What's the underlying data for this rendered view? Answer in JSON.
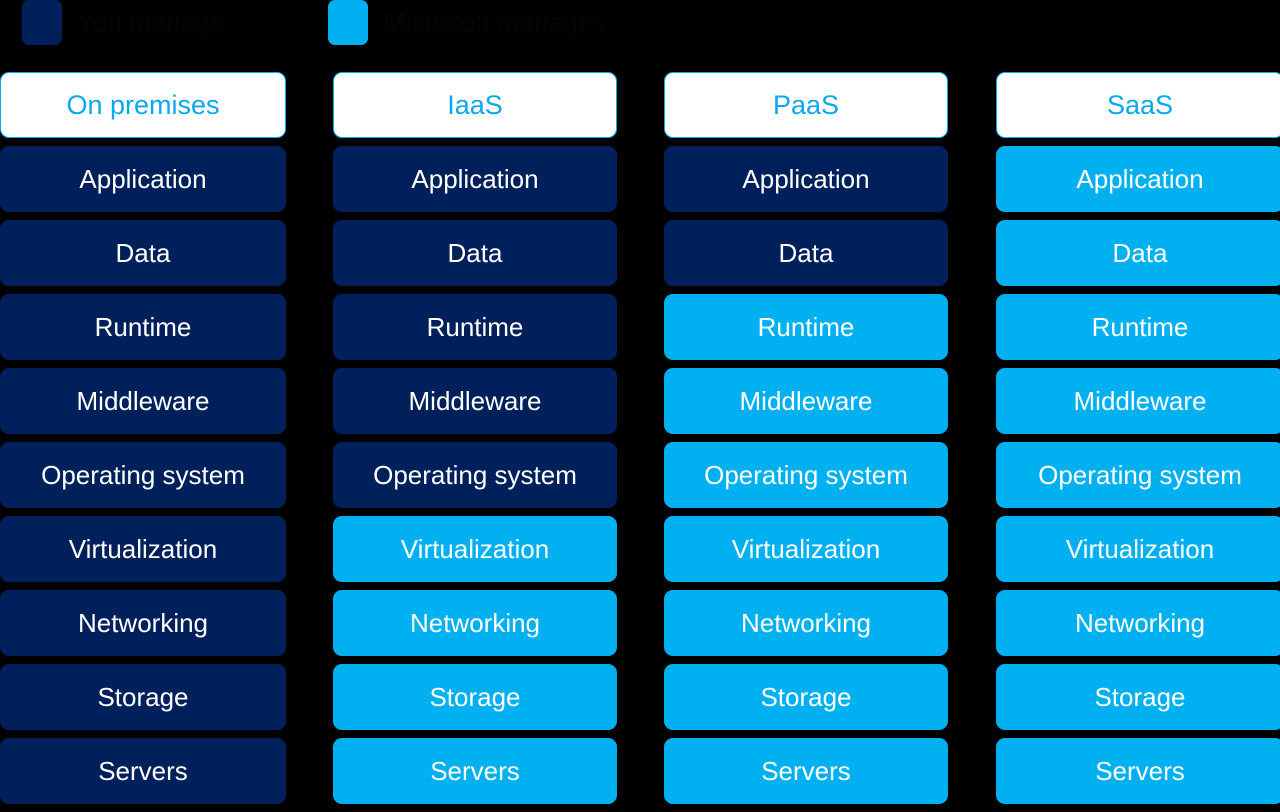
{
  "legend": {
    "items": [
      {
        "id": "you-manage",
        "label": "You manage",
        "swatch": "navy",
        "color": "#00205b"
      },
      {
        "id": "provider-manages",
        "label": "Microsoft manages",
        "swatch": "cyan",
        "color": "#00b0f0"
      }
    ]
  },
  "colors": {
    "background": "#000000",
    "navy": "#00205b",
    "cyan": "#00b0f0",
    "header_bg": "#ffffff",
    "header_text": "#0aa8f0",
    "card_text": "#ffffff"
  },
  "layers": [
    "Application",
    "Data",
    "Runtime",
    "Middleware",
    "Operating system",
    "Virtualization",
    "Networking",
    "Storage",
    "Servers"
  ],
  "columns": [
    {
      "id": "on-premises",
      "header": "On premises",
      "cells": [
        {
          "label": "Application",
          "owner": "navy"
        },
        {
          "label": "Data",
          "owner": "navy"
        },
        {
          "label": "Runtime",
          "owner": "navy"
        },
        {
          "label": "Middleware",
          "owner": "navy"
        },
        {
          "label": "Operating system",
          "owner": "navy"
        },
        {
          "label": "Virtualization",
          "owner": "navy"
        },
        {
          "label": "Networking",
          "owner": "navy"
        },
        {
          "label": "Storage",
          "owner": "navy"
        },
        {
          "label": "Servers",
          "owner": "navy"
        }
      ]
    },
    {
      "id": "iaas",
      "header": "IaaS",
      "cells": [
        {
          "label": "Application",
          "owner": "navy"
        },
        {
          "label": "Data",
          "owner": "navy"
        },
        {
          "label": "Runtime",
          "owner": "navy"
        },
        {
          "label": "Middleware",
          "owner": "navy"
        },
        {
          "label": "Operating system",
          "owner": "navy"
        },
        {
          "label": "Virtualization",
          "owner": "cyan"
        },
        {
          "label": "Networking",
          "owner": "cyan"
        },
        {
          "label": "Storage",
          "owner": "cyan"
        },
        {
          "label": "Servers",
          "owner": "cyan"
        }
      ]
    },
    {
      "id": "paas",
      "header": "PaaS",
      "cells": [
        {
          "label": "Application",
          "owner": "navy"
        },
        {
          "label": "Data",
          "owner": "navy"
        },
        {
          "label": "Runtime",
          "owner": "cyan"
        },
        {
          "label": "Middleware",
          "owner": "cyan"
        },
        {
          "label": "Operating system",
          "owner": "cyan"
        },
        {
          "label": "Virtualization",
          "owner": "cyan"
        },
        {
          "label": "Networking",
          "owner": "cyan"
        },
        {
          "label": "Storage",
          "owner": "cyan"
        },
        {
          "label": "Servers",
          "owner": "cyan"
        }
      ]
    },
    {
      "id": "saas",
      "header": "SaaS",
      "cells": [
        {
          "label": "Application",
          "owner": "cyan"
        },
        {
          "label": "Data",
          "owner": "cyan"
        },
        {
          "label": "Runtime",
          "owner": "cyan"
        },
        {
          "label": "Middleware",
          "owner": "cyan"
        },
        {
          "label": "Operating system",
          "owner": "cyan"
        },
        {
          "label": "Virtualization",
          "owner": "cyan"
        },
        {
          "label": "Networking",
          "owner": "cyan"
        },
        {
          "label": "Storage",
          "owner": "cyan"
        },
        {
          "label": "Servers",
          "owner": "cyan"
        }
      ]
    }
  ]
}
